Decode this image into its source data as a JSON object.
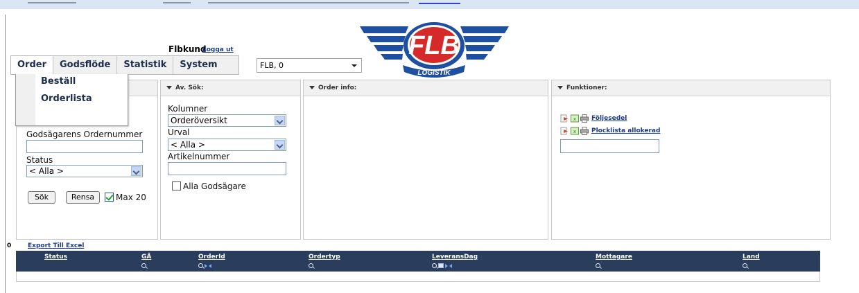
{
  "header": {
    "user_name": "Flbkund",
    "logout": "Logga ut",
    "company_select": "FLB, 0"
  },
  "logo": {
    "text": "FLB",
    "subtext": "LOGISTIK",
    "colors": {
      "blue": "#1f4fa0",
      "red": "#d62a2a"
    }
  },
  "menu": {
    "items": [
      {
        "label": "Order"
      },
      {
        "label": "Godsflöde"
      },
      {
        "label": "Statistik"
      },
      {
        "label": "System"
      }
    ],
    "dropdown": [
      {
        "label": "Beställ"
      },
      {
        "label": "Orderlista"
      }
    ]
  },
  "search_panel": {
    "label_godsagare_ordernr": "Godsägarens Ordernummer",
    "label_status": "Status",
    "status_value": "< Alla >",
    "search_button": "Sök",
    "clear_button": "Rensa",
    "max_label": "Max 20",
    "max_checked": true
  },
  "adv_panel": {
    "title": "Av. Sök:",
    "label_columns": "Kolumner",
    "columns_value": "Orderöversikt",
    "label_selection": "Urval",
    "selection_value": "< Alla >",
    "label_article": "Artikelnummer",
    "all_owners_label": "Alla Godsägare"
  },
  "info_panel": {
    "title": "Order info:"
  },
  "functions_panel": {
    "title": "Funktioner:",
    "items": [
      {
        "label": "Följesedel",
        "icons": [
          "arrow-icon",
          "excel-icon",
          "printer-icon"
        ]
      },
      {
        "label": "Plocklista allokerad",
        "icons": [
          "arrow-icon",
          "excel-icon",
          "printer-icon"
        ]
      }
    ]
  },
  "grid": {
    "count": "0",
    "export": "Export Till Excel",
    "columns": [
      {
        "label": "Status"
      },
      {
        "label": "GÄ"
      },
      {
        "label": "OrderId"
      },
      {
        "label": "Ordertyp"
      },
      {
        "label": "LeveransDag"
      },
      {
        "label": "Mottagare"
      },
      {
        "label": "Land"
      }
    ],
    "header_color": "#2b3d5c"
  }
}
